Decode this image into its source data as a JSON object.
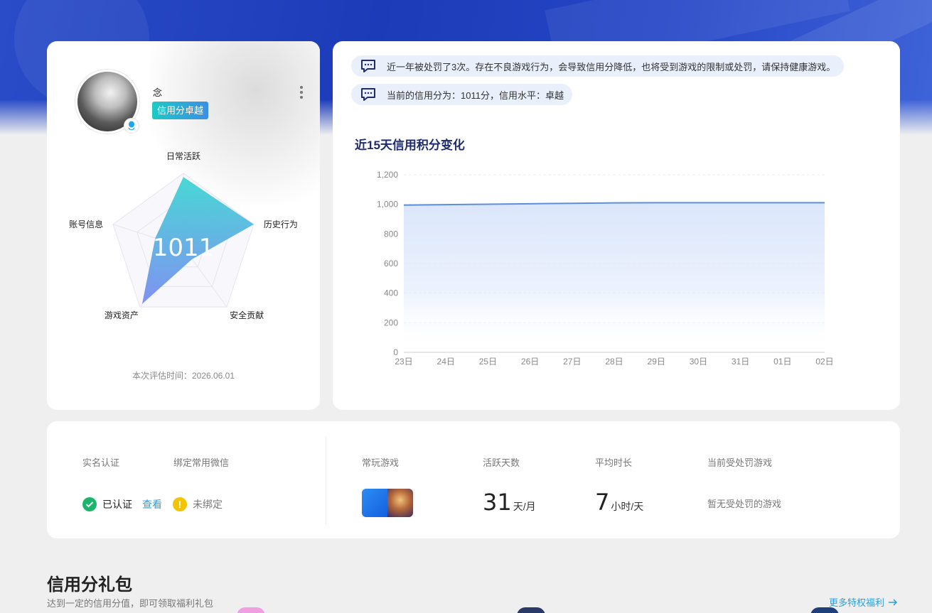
{
  "profile": {
    "username": "念",
    "level_badge": "信用分卓越",
    "eval_time": "本次评估时间：2026.06.01",
    "radar": {
      "score": "1011",
      "axes": [
        "日常活跃",
        "历史行为",
        "安全贡献",
        "游戏资产",
        "账号信息"
      ],
      "values": [
        0.95,
        1.0,
        0.2,
        0.95,
        0.4
      ]
    }
  },
  "notices": [
    "近一年被处罚了3次。存在不良游戏行为，会导致信用分降低，也将受到游戏的限制或处罚，请保持健康游戏。",
    "当前的信用分为：1011分，信用水平：卓越"
  ],
  "chart_title": "近15天信用积分变化",
  "chart_data": {
    "type": "area",
    "title": "近15天信用积分变化",
    "categories": [
      "23日",
      "24日",
      "25日",
      "26日",
      "27日",
      "28日",
      "29日",
      "30日",
      "31日",
      "01日",
      "02日"
    ],
    "series": [
      {
        "values": [
          995,
          998,
          1001,
          1004,
          1007,
          1010,
          1011,
          1011,
          1011,
          1011,
          1011
        ]
      }
    ],
    "y_ticks": [
      "0",
      "200",
      "400",
      "600",
      "800",
      "1,000",
      "1,200"
    ],
    "ylim": [
      0,
      1200
    ],
    "grid": true,
    "colors": {
      "line": "#5b8ee0",
      "fill_top": "#dbe6fb",
      "fill_bottom": "#ffffff"
    }
  },
  "stats": {
    "realname_label": "实名认证",
    "realname_status": "已认证",
    "realname_view": "查看",
    "wechat_label": "绑定常用微信",
    "wechat_status": "未绑定",
    "games_label": "常玩游戏",
    "active_label": "活跃天数",
    "active_value": "31",
    "active_unit": "天/月",
    "avg_label": "平均时长",
    "avg_value": "7",
    "avg_unit": "小时/天",
    "punish_label": "当前受处罚游戏",
    "punish_value": "暂无受处罚的游戏"
  },
  "gift": {
    "title": "信用分礼包",
    "subtitle": "达到一定的信用分值，即可领取福利礼包",
    "more": "更多特权福利"
  },
  "colors": {
    "brand_blue": "#1c3bb8",
    "accent_teal": "#1ec9c4",
    "link": "#2aa0d8",
    "success": "#1db56c",
    "warning": "#f5c400"
  }
}
